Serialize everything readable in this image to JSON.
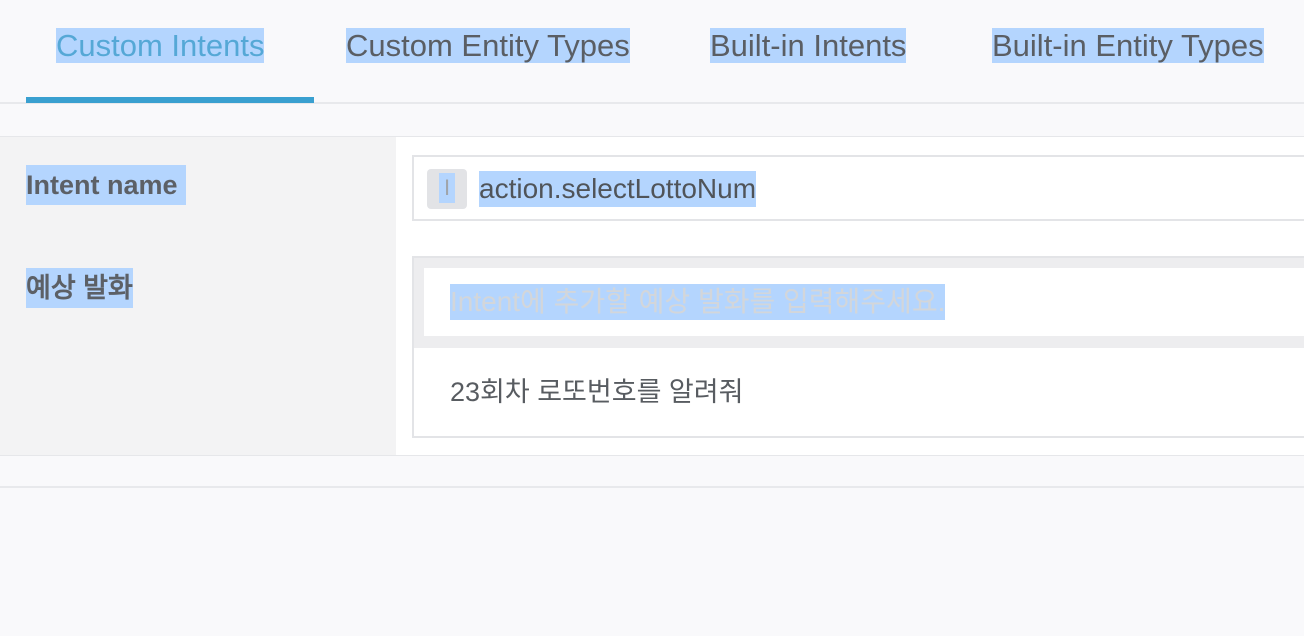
{
  "tabs": [
    {
      "label": "Custom Intents",
      "active": true
    },
    {
      "label": "Custom Entity Types",
      "active": false
    },
    {
      "label": "Built-in Intents",
      "active": false
    },
    {
      "label": "Built-in Entity Types",
      "active": false
    }
  ],
  "form": {
    "intent_name_label": "Intent name",
    "intent_icon": "I",
    "intent_name_value": "action.selectLottoNum",
    "utterances_label": "예상 발화",
    "utterance_placeholder": "Intent에 추가할 예상 발화를 입력해주세요.",
    "utterances": [
      "23회차 로또번호를 알려줘"
    ]
  },
  "colors": {
    "accent": "#3aa0d0",
    "selection": "#b4d5fe"
  }
}
